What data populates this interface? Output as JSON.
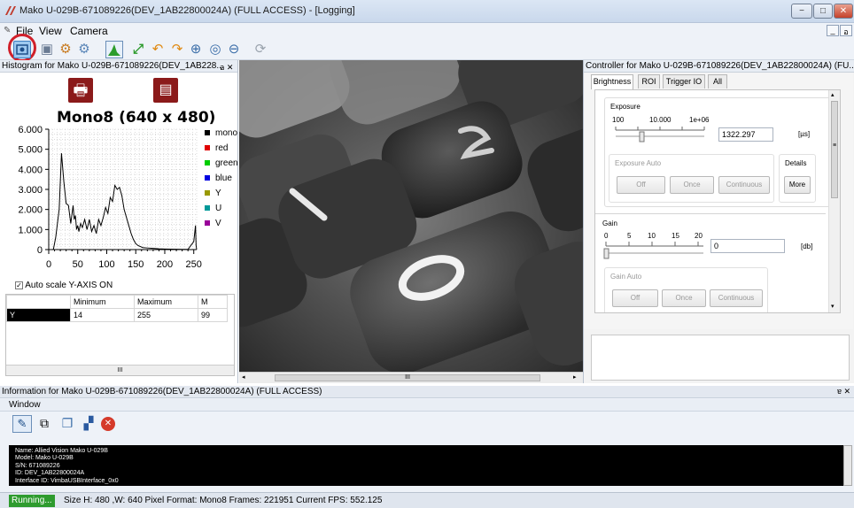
{
  "window": {
    "title": "Mako U-029B-671089226(DEV_1AB22800024A) (FULL ACCESS) - [Logging]",
    "minimize": "−",
    "maximize": "□",
    "close": "✕",
    "mdi_min": "_",
    "mdi_restore": "อ",
    "mdi_close": "x"
  },
  "menu": {
    "file": "File",
    "view": "View",
    "camera": "Camera"
  },
  "toolbar": {
    "icons": [
      "freerun-icon",
      "save-icon",
      "settings-icon",
      "settings2-icon",
      "histogram-icon",
      "fullscreen-icon",
      "rotate-left-icon",
      "rotate-right-icon",
      "zoom-in-icon",
      "zoom-reset-icon",
      "zoom-out-icon",
      "refresh-icon"
    ]
  },
  "histogram": {
    "header": "Histogram for Mako U-029B-671089226(DEV_1AB228...",
    "header_btns": "อ ✕",
    "format": "Mono8 (640 x 480)",
    "autoscale_label": "Auto scale Y-AXIS ON",
    "y_ticks": [
      "6.000",
      "5.000",
      "4.000",
      "3.000",
      "2.000",
      "1.000",
      "0"
    ],
    "x_ticks": [
      "0",
      "50",
      "100",
      "150",
      "200",
      "250"
    ],
    "legend": [
      {
        "name": "mono",
        "color": "#000000"
      },
      {
        "name": "red",
        "color": "#e00000"
      },
      {
        "name": "green",
        "color": "#00cc00"
      },
      {
        "name": "blue",
        "color": "#0000e0"
      },
      {
        "name": "Y",
        "color": "#999900"
      },
      {
        "name": "U",
        "color": "#009999"
      },
      {
        "name": "V",
        "color": "#990099"
      }
    ],
    "table": {
      "headers": [
        "",
        "Minimum",
        "Maximum",
        "M"
      ],
      "rows": [
        [
          "Y",
          "14",
          "255",
          "99"
        ]
      ]
    },
    "scroll_mark": "III"
  },
  "chart_data": {
    "type": "line",
    "ylim": [
      0,
      6000
    ],
    "xlim": [
      0,
      255
    ],
    "series": [
      {
        "name": "mono",
        "x": [
          0,
          8,
          12,
          18,
          22,
          26,
          30,
          34,
          38,
          42,
          44,
          46,
          48,
          50,
          52,
          55,
          58,
          62,
          66,
          70,
          74,
          78,
          82,
          86,
          90,
          94,
          98,
          102,
          106,
          110,
          114,
          118,
          122,
          126,
          130,
          134,
          138,
          142,
          146,
          150,
          154,
          158,
          162,
          170,
          180,
          190,
          200,
          210,
          220,
          230,
          240,
          250,
          253,
          254,
          255
        ],
        "y": [
          0,
          0,
          600,
          2000,
          4800,
          3400,
          2300,
          2200,
          1300,
          2200,
          1500,
          1700,
          1000,
          1200,
          900,
          1300,
          1100,
          1500,
          1000,
          1500,
          900,
          1200,
          800,
          1500,
          1200,
          1600,
          2100,
          1800,
          2600,
          2400,
          3200,
          3000,
          3100,
          2700,
          2000,
          1600,
          1200,
          800,
          500,
          300,
          200,
          150,
          100,
          80,
          60,
          40,
          30,
          20,
          15,
          10,
          10,
          400,
          1200,
          200,
          0
        ]
      }
    ]
  },
  "image": {
    "scroll_mark": "III"
  },
  "controller": {
    "header": "Controller for Mako U-029B-671089226(DEV_1AB22800024A) (FU...",
    "tabs": [
      "Brightness",
      "ROI",
      "Trigger IO",
      "All"
    ],
    "exposure": {
      "title": "Exposure",
      "ticks": [
        "100",
        "10.000",
        "1e+06"
      ],
      "value": "1322.297",
      "unit": "[µs]",
      "slider_level": 0.25
    },
    "exposure_auto": {
      "title": "Exposure Auto",
      "off": "Off",
      "once": "Once",
      "continuous": "Continuous"
    },
    "details": {
      "title": "Details",
      "more": "More"
    },
    "gain": {
      "title": "Gain",
      "ticks": [
        "0",
        "5",
        "10",
        "15",
        "20"
      ],
      "value": "0",
      "unit": "[db]",
      "slider_level": 0.0
    },
    "gain_auto": {
      "title": "Gain Auto",
      "off": "Off",
      "once": "Once",
      "continuous": "Continuous"
    },
    "scroll_marker": "≡"
  },
  "info": {
    "header": "Information for Mako U-029B-671089226(DEV_1AB22800024A) (FULL ACCESS)",
    "window_label": "Window",
    "lines": [
      "Name: Allied Vision Mako U-029B",
      "Model: Mako U-029B",
      "S/N: 671089226",
      "ID: DEV_1AB22800024A",
      "Interface ID: VimbaUSBInterface_0x0"
    ]
  },
  "status": {
    "running": "Running...",
    "text": "Size H: 480 ,W: 640  Pixel Format: Mono8  Frames: 221951  Current FPS: 552.125"
  }
}
